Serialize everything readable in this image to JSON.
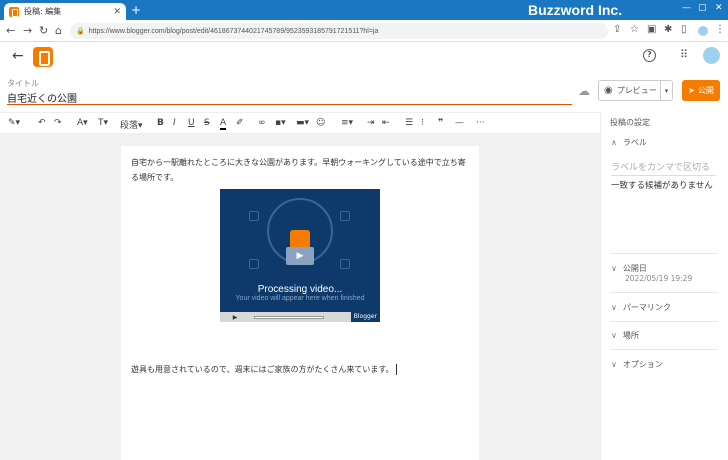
{
  "browser": {
    "tab_title": "投稿: 編集",
    "tab_close": "✕",
    "new_tab": "+",
    "window_title": "Buzzword Inc.",
    "url": "https://www.blogger.com/blog/post/edit/4618673744021745789/9523593185791721511?hl=ja"
  },
  "editor": {
    "title_label": "タイトル",
    "title_value": "自宅近くの公園",
    "preview_label": "プレビュー",
    "publish_label": "公開",
    "paragraph_style": "段落",
    "body_paragraph_1": "自宅から一駅離れたところに大きな公園があります。早朝ウォーキングしている途中で立ち寄る場所です。",
    "body_paragraph_2": "遊具も用意されているので、週末にはご家族の方がたくさん来ています。",
    "video_processing_title": "Processing video...",
    "video_processing_sub": "Your video will appear here when finished",
    "video_brand": "Blogger"
  },
  "sidebar": {
    "heading": "投稿の設定",
    "labels_title": "ラベル",
    "labels_placeholder": "ラベルをカンマで区切る",
    "no_match": "一致する候補がありません",
    "publish_date_title": "公開日",
    "publish_date_value": "2022/05/19 19:29",
    "permalink_title": "パーマリンク",
    "location_title": "場所",
    "options_title": "オプション"
  },
  "colors": {
    "accent": "#f57c00",
    "browser_bar": "#1a78c2",
    "video_bg": "#0d3a6b"
  },
  "icons": [
    "back-arrow-icon",
    "forward-arrow-icon",
    "reload-icon",
    "home-icon",
    "lock-icon",
    "share-icon",
    "star-icon",
    "extension-icon",
    "sidebar-icon",
    "menu-icon",
    "help-icon",
    "apps-icon",
    "cloud-icon",
    "eye-icon",
    "send-icon",
    "pen-icon",
    "undo-icon",
    "redo-icon",
    "font-icon",
    "font-size-icon",
    "bold-icon",
    "italic-icon",
    "underline-icon",
    "strikethrough-icon",
    "text-color-icon",
    "highlight-icon",
    "link-icon",
    "image-icon",
    "video-icon",
    "emoji-icon",
    "align-icon",
    "indent-icon",
    "outdent-icon",
    "bulleted-list-icon",
    "numbered-list-icon",
    "quote-icon",
    "divider-icon",
    "more-icon",
    "chevron-icon"
  ]
}
